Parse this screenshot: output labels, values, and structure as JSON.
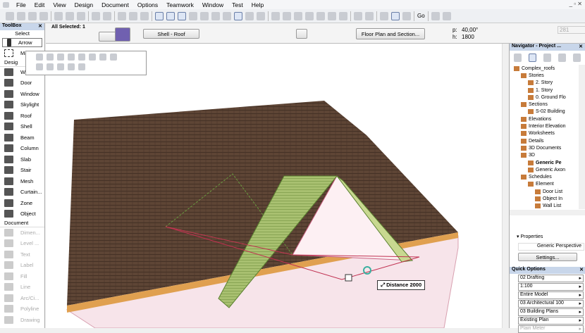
{
  "menu": [
    "File",
    "Edit",
    "View",
    "Design",
    "Document",
    "Options",
    "Teamwork",
    "Window",
    "Test",
    "Help"
  ],
  "toolbar": {
    "go_label": "Go"
  },
  "infobox": {
    "selection": "All Selected: 1",
    "layer": "Shell - Roof",
    "floor_plan_button": "Floor Plan and Section...",
    "angle_label": "p:",
    "angle_value": "40,00°",
    "height_label": "h:",
    "height_value": "1800",
    "field_value": "281"
  },
  "toolbox": {
    "title": "ToolBox",
    "select_header": "Select",
    "arrow": "Arrow",
    "marquee": "Ma",
    "design_group": "Desig",
    "tools": [
      "Wall",
      "Door",
      "Window",
      "Skylight",
      "Roof",
      "Shell",
      "Beam",
      "Column",
      "Slab",
      "Stair",
      "Mesh",
      "Curtain...",
      "Zone",
      "Object"
    ],
    "document_group": "Document",
    "doc_tools": [
      "Dimen...",
      "Level ...",
      "Text",
      "Label",
      "Fill",
      "Line",
      "Arc/Ci...",
      "Polyline",
      "Drawing"
    ]
  },
  "viewport": {
    "distance_label": "Distance",
    "distance_value": "2000",
    "colors": {
      "roof": "#5e4535",
      "fascia": "#e0a050",
      "shell": "#a8c070",
      "wall": "#f7e4ea"
    }
  },
  "navigator": {
    "title": "Navigator - Project ...",
    "tree": [
      "Complex_roofs",
      "Stories",
      "2. Story",
      "1. Story",
      "0. Ground Flo",
      "Sections",
      "S-02 Building",
      "Elevations",
      "Interior Elevation",
      "Worksheets",
      "Details",
      "3D Documents",
      "3D",
      "Generic Pe",
      "Generic Axon",
      "Schedules",
      "Element",
      "Door List",
      "Object In",
      "Wall List"
    ],
    "properties_label": "Properties",
    "view_name": "Generic Perspective",
    "settings_button": "Settings..."
  },
  "quick_options": {
    "title": "Quick Options",
    "items": [
      "02 Drafting",
      "1:100",
      "Entire Model",
      "03 Architectural 100",
      "03 Building Plans",
      "Existing Plan",
      "Plain Meter"
    ]
  }
}
